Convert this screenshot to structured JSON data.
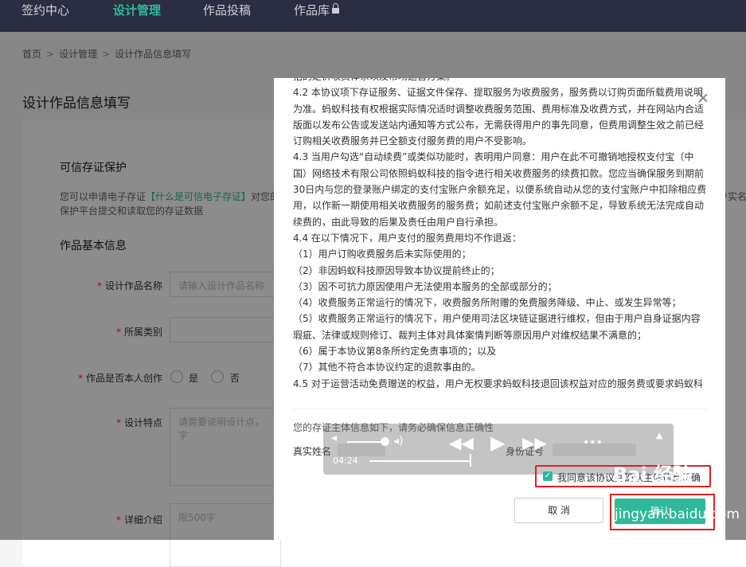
{
  "nav": {
    "items": [
      {
        "label": "签约中心"
      },
      {
        "label": "设计管理"
      },
      {
        "label": "作品投稿"
      },
      {
        "label": "作品库"
      }
    ]
  },
  "breadcrumb": [
    "首页",
    "设计管理",
    "设计作品信息填写"
  ],
  "page": {
    "title": "设计作品信息填写",
    "trust_section": {
      "title": "可信存证保护",
      "desc_prefix": "您可以申请电子存证",
      "desc_link": "【什么是可信电子存证】",
      "desc_suffix": "对您的",
      "desc_right": "户实名",
      "desc_line2": "保护平台提交和读取您的存证数据"
    },
    "basic_info": {
      "title": "作品基本信息",
      "name_label": "设计作品名称",
      "name_placeholder": "请输入设计作品名称",
      "category_label": "所属类别",
      "original_label": "作品是否本人创作",
      "yes": "是",
      "no": "否",
      "feature_label": "设计特点",
      "feature_placeholder": "请需要说明设计点，字",
      "detail_label": "详细介绍",
      "detail_placeholder": "限500字"
    }
  },
  "modal": {
    "agreement": [
      {
        "text": "括的定价收费体系以及市场运营方案。",
        "hd": false
      },
      {
        "text": "4.2 本协议项下存证服务、证据文件保存、提取服务为收费服务，服务费以订购页面所载费用说明为准。蚂蚁科技有权根据实际情况适时调整收费服务范围、费用标准及收费方式，并在网站内合适版面以发布公告或发送站内通知等方式公布，无需获得用户的事先同意，但费用调整生效之前已经订购相关收费服务并已全额支付服务费的用户不受影响。",
        "hd": false
      },
      {
        "text": "4.3 当用户勾选“自动续费”或类似功能时，表明用户同意：用户在此不可撤销地授权支付宝（中国）网络技术有限公司依照蚂蚁科技的指令进行相关收费服务的续费扣款。您应当确保服务到期前30日内与您的登录账户绑定的支付宝账户余额充足，以便系统自动从您的支付宝账户中扣除相应费用，以作新一期使用相关收费服务的服务费；如前述支付宝账户余额不足，导致系统无法完成自动续费的，由此导致的后果及责任由用户自行承担。",
        "hd": false
      },
      {
        "text": "4.4 在以下情况下，用户支付的服务费用均不作退返：",
        "hd": false
      },
      {
        "text": "（1）用户订购收费服务后未实际使用的；",
        "hd": false
      },
      {
        "text": "（2）非因蚂蚁科技原因导致本协议提前终止的；",
        "hd": false
      },
      {
        "text": "（3）因不可抗力原因使用户无法使用本服务的全部或部分的；",
        "hd": false
      },
      {
        "text": "（4）收费服务正常运行的情况下，收费服务所附赠的免费服务降级、中止、或发生异常等；",
        "hd": false
      },
      {
        "text": "（5）收费服务正常运行的情况下，用户使用司法区块链证据进行维权，但由于用户自身证据内容瑕疵、法律或规则修订、裁判主体对具体案情判断等原因用户对维权结果不满意的；",
        "hd": false
      },
      {
        "text": "（6）属于本协议第8条所约定免责事项的；以及",
        "hd": false
      },
      {
        "text": "（7）其他不符合本协议约定的退款事由的。",
        "hd": false
      },
      {
        "text": "4.5 对于运营活动免费赠送的权益，用户无权要求蚂蚁科技退回该权益对应的服务费或要求蚂蚁科",
        "hd": false
      }
    ],
    "info_tip": "您的存证主体信息如下，请务必确保信息正确性",
    "real_name_label": "真实姓名",
    "id_label": "身份证号",
    "agree_text": "我同意该协议并确认主体信息正确",
    "cancel": "取 消",
    "confirm": "确认"
  },
  "player": {
    "time": "04:24"
  },
  "watermark": {
    "main": "Bai 经验",
    "sub": "jingyan.baidu.com"
  },
  "colors": {
    "accent": "#2fb99a",
    "nav_bg": "#2b2d42",
    "highlight_red": "#e02020"
  }
}
